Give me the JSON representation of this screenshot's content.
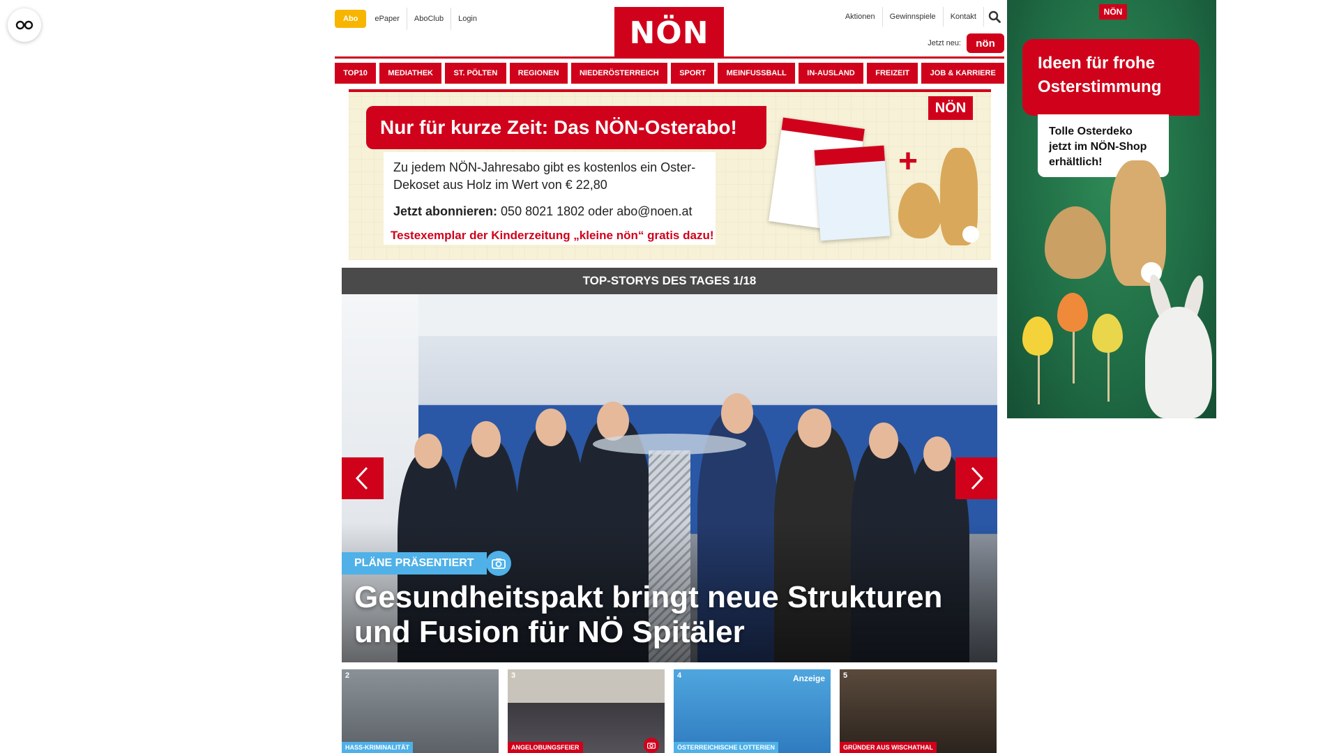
{
  "header": {
    "abo_label": "Abo",
    "links_left": [
      "ePaper",
      "AboClub",
      "Login"
    ],
    "logo_text": "NÖN",
    "links_right": [
      "Aktionen",
      "Gewinnspiele",
      "Kontakt"
    ],
    "jetzt_neu_label": "Jetzt neu:",
    "kleine_badge": "nön"
  },
  "nav": {
    "items": [
      "TOP10",
      "MEDIATHEK",
      "ST. PÖLTEN",
      "REGIONEN",
      "NIEDERÖSTERREICH",
      "SPORT",
      "MEINFUSSBALL",
      "IN-AUSLAND",
      "FREIZEIT",
      "JOB & KARRIERE"
    ]
  },
  "promo": {
    "logo": "NÖN",
    "headline": "Nur für kurze Zeit: Das NÖN-Osterabo!",
    "text": "Zu jedem NÖN-Jahresabo gibt es kostenlos ein Oster-Dekoset aus Holz im Wert von € 22,80",
    "abo_label": "Jetzt abonnieren:",
    "abo_contact": "050 8021 1802 oder abo@noen.at",
    "test_offer": "Testexemplar der Kinderzeitung „kleine nön“ gratis dazu!"
  },
  "stories": {
    "heading": "TOP-STORYS DES TAGES 1/18",
    "hero": {
      "tag": "PLÄNE PRÄSENTIERT",
      "title": "Gesundheitspakt bringt neue Strukturen und Fusion für NÖ Spitäler"
    },
    "thumbs": [
      {
        "num": "2",
        "tag": "HASS-KRIMINALITÄT",
        "tag_color": "#4fb1e8",
        "ad": ""
      },
      {
        "num": "3",
        "tag": "ANGELOBUNGSFEIER",
        "tag_color": "#d0021b",
        "ad": ""
      },
      {
        "num": "4",
        "tag": "ÖSTERREICHISCHE LOTTERIEN",
        "tag_color": "#4fb1e8",
        "ad": "Anzeige"
      },
      {
        "num": "5",
        "tag": "GRÜNDER AUS WISCHATHAL",
        "tag_color": "#d0021b",
        "ad": ""
      }
    ]
  },
  "side_ad": {
    "logo": "NÖN",
    "headline": "Ideen für frohe Osterstimmung",
    "subline": "Tolle Osterdeko jetzt im NÖN-Shop erhältlich!"
  },
  "colors": {
    "brand_red": "#d0021b",
    "abo_yellow": "#f7b500",
    "story_blue": "#4fb1e8",
    "ad_green": "#1f6b44"
  },
  "icons": {
    "left_float": "glasses-icon",
    "search": "search-icon",
    "prev": "chevron-left-icon",
    "next": "chevron-right-icon",
    "camera": "camera-icon"
  }
}
